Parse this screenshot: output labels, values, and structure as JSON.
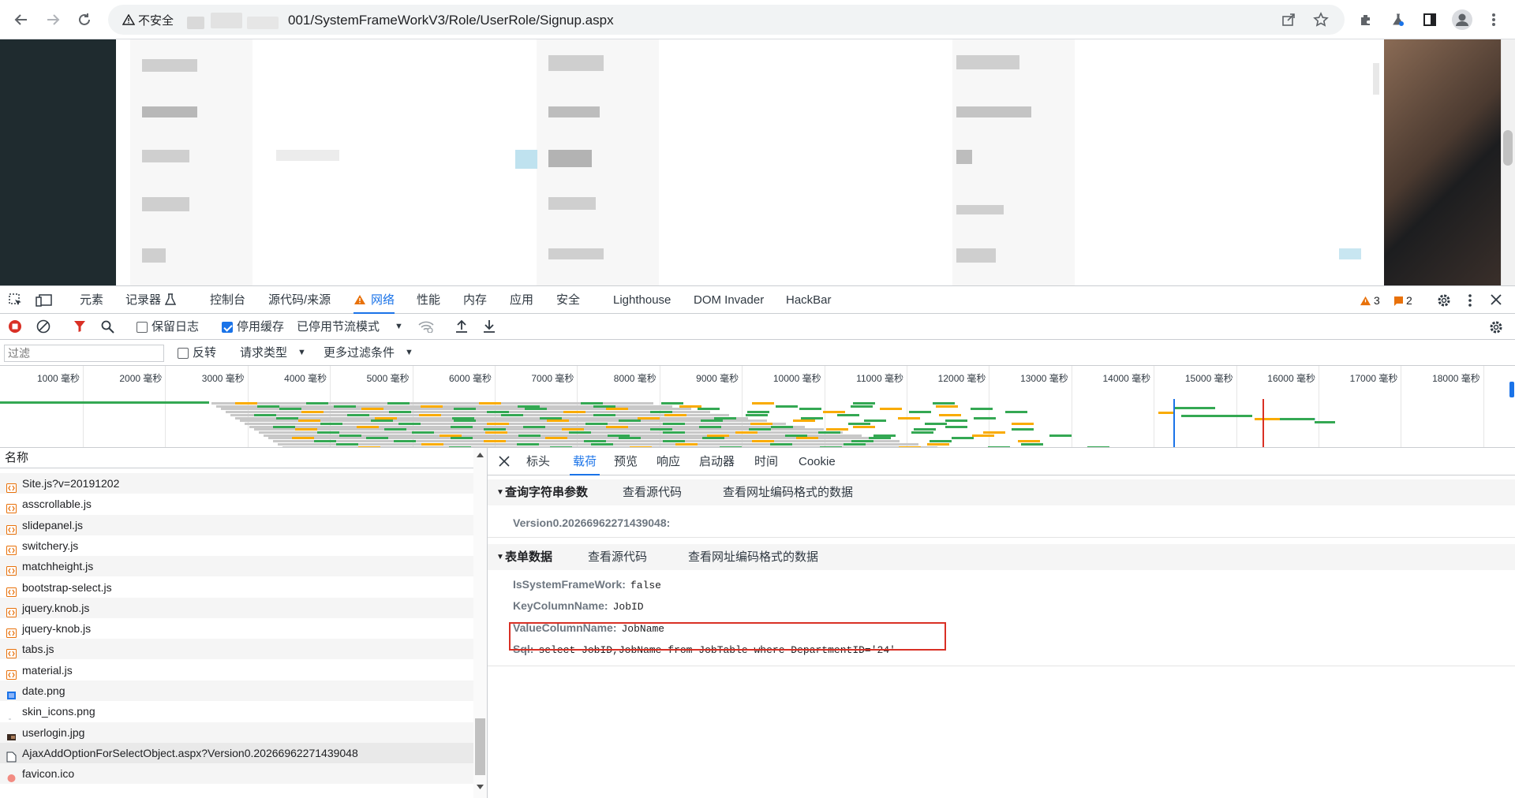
{
  "browser": {
    "security_label": "不安全",
    "url": "001/SystemFrameWorkV3/Role/UserRole/Signup.aspx"
  },
  "devtools": {
    "tabs": [
      "元素",
      "记录器",
      "控制台",
      "源代码/来源",
      "网络",
      "性能",
      "内存",
      "应用",
      "安全",
      "Lighthouse",
      "DOM Invader",
      "HackBar"
    ],
    "warnings_count": "3",
    "errors_count": "2",
    "toolbar": {
      "preserve_log": "保留日志",
      "disable_cache": "停用缓存",
      "throttling": "已停用节流模式"
    },
    "filter": {
      "placeholder": "过滤",
      "invert": "反转",
      "request_types": "请求类型",
      "more_filters": "更多过滤条件"
    },
    "timeline_ticks": [
      "1000 毫秒",
      "2000 毫秒",
      "3000 毫秒",
      "4000 毫秒",
      "5000 毫秒",
      "6000 毫秒",
      "7000 毫秒",
      "8000 毫秒",
      "9000 毫秒",
      "10000 毫秒",
      "11000 毫秒",
      "12000 毫秒",
      "13000 毫秒",
      "14000 毫秒",
      "15000 毫秒",
      "16000 毫秒",
      "17000 毫秒",
      "18000 毫秒"
    ],
    "request_list": {
      "header": "名称",
      "rows": [
        {
          "name": "Site.js?v=20191202",
          "type": "js"
        },
        {
          "name": "asscrollable.js",
          "type": "js"
        },
        {
          "name": "slidepanel.js",
          "type": "js"
        },
        {
          "name": "switchery.js",
          "type": "js"
        },
        {
          "name": "matchheight.js",
          "type": "js"
        },
        {
          "name": "bootstrap-select.js",
          "type": "js"
        },
        {
          "name": "jquery.knob.js",
          "type": "js"
        },
        {
          "name": "jquery-knob.js",
          "type": "js"
        },
        {
          "name": "tabs.js",
          "type": "js"
        },
        {
          "name": "material.js",
          "type": "js"
        },
        {
          "name": "date.png",
          "type": "img"
        },
        {
          "name": "skin_icons.png",
          "type": "img-blank"
        },
        {
          "name": "userlogin.jpg",
          "type": "img-dark"
        },
        {
          "name": "AjaxAddOptionForSelectObject.aspx?Version0.20266962271439048",
          "type": "doc"
        },
        {
          "name": "favicon.ico",
          "type": "ico"
        }
      ]
    },
    "detail": {
      "tabs": [
        "标头",
        "载荷",
        "预览",
        "响应",
        "启动器",
        "时间",
        "Cookie"
      ],
      "query_section": {
        "title": "查询字符串参数",
        "view_source": "查看源代码",
        "view_encoded": "查看网址编码格式的数据",
        "params": [
          {
            "key": "Version0.20266962271439048:",
            "value": ""
          }
        ]
      },
      "form_section": {
        "title": "表单数据",
        "view_source": "查看源代码",
        "view_encoded": "查看网址编码格式的数据",
        "params": [
          {
            "key": "IsSystemFrameWork:",
            "value": "false"
          },
          {
            "key": "KeyColumnName:",
            "value": "JobID"
          },
          {
            "key": "ValueColumnName:",
            "value": "JobName"
          },
          {
            "key": "Sql:",
            "value": "select JobID,JobName from JobTable where DepartmentID='24'"
          }
        ]
      }
    }
  }
}
